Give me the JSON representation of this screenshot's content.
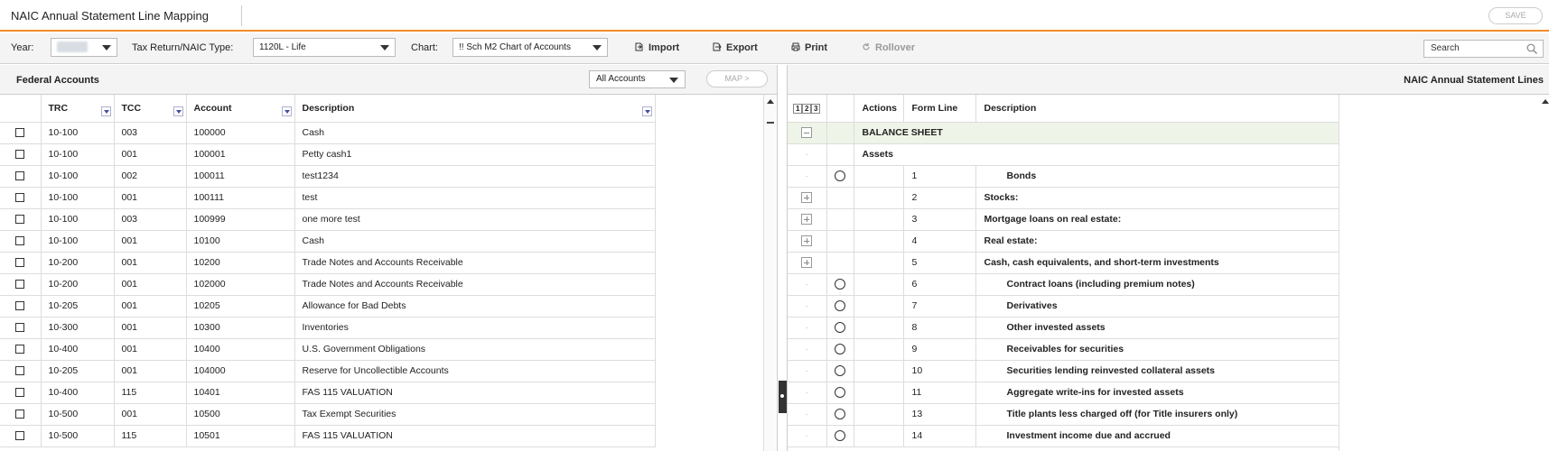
{
  "app": {
    "title": "NAIC Annual Statement Line Mapping",
    "save_label": "SAVE"
  },
  "toolbar": {
    "year_label": "Year:",
    "tax_type_label": "Tax Return/NAIC Type:",
    "tax_type_value": "1120L - Life",
    "chart_label": "Chart:",
    "chart_value": "!! Sch M2 Chart of Accounts",
    "import_label": "Import",
    "export_label": "Export",
    "print_label": "Print",
    "rollover_label": "Rollover",
    "search_placeholder": "Search"
  },
  "left_panel": {
    "title": "Federal Accounts",
    "filter_value": "All Accounts",
    "map_label": "MAP >",
    "columns": [
      "TRC",
      "TCC",
      "Account",
      "Description"
    ],
    "rows": [
      {
        "trc": "10-100",
        "tcc": "003",
        "account": "100000",
        "desc": "Cash"
      },
      {
        "trc": "10-100",
        "tcc": "001",
        "account": "100001",
        "desc": "Petty cash1"
      },
      {
        "trc": "10-100",
        "tcc": "002",
        "account": "100011",
        "desc": "test1234"
      },
      {
        "trc": "10-100",
        "tcc": "001",
        "account": "100111",
        "desc": "test"
      },
      {
        "trc": "10-100",
        "tcc": "003",
        "account": "100999",
        "desc": "one more test"
      },
      {
        "trc": "10-100",
        "tcc": "001",
        "account": "10100",
        "desc": "Cash"
      },
      {
        "trc": "10-200",
        "tcc": "001",
        "account": "10200",
        "desc": "Trade Notes and Accounts Receivable"
      },
      {
        "trc": "10-200",
        "tcc": "001",
        "account": "102000",
        "desc": "Trade Notes and Accounts Receivable"
      },
      {
        "trc": "10-205",
        "tcc": "001",
        "account": "10205",
        "desc": "Allowance for Bad Debts"
      },
      {
        "trc": "10-300",
        "tcc": "001",
        "account": "10300",
        "desc": "Inventories"
      },
      {
        "trc": "10-400",
        "tcc": "001",
        "account": "10400",
        "desc": "U.S. Government Obligations"
      },
      {
        "trc": "10-205",
        "tcc": "001",
        "account": "104000",
        "desc": "Reserve for Uncollectible Accounts"
      },
      {
        "trc": "10-400",
        "tcc": "115",
        "account": "10401",
        "desc": "FAS 115 VALUATION"
      },
      {
        "trc": "10-500",
        "tcc": "001",
        "account": "10500",
        "desc": "Tax Exempt Securities"
      },
      {
        "trc": "10-500",
        "tcc": "115",
        "account": "10501",
        "desc": "FAS 115 VALUATION"
      }
    ]
  },
  "right_panel": {
    "title": "NAIC Annual Statement Lines",
    "levels": [
      "1",
      "2",
      "3"
    ],
    "columns": [
      "Actions",
      "Form Line",
      "Description"
    ],
    "rows": [
      {
        "kind": "section",
        "line": "",
        "desc": "BALANCE SHEET"
      },
      {
        "kind": "group",
        "line": "",
        "desc": "Assets"
      },
      {
        "kind": "leaf",
        "line": "1",
        "desc": "Bonds"
      },
      {
        "kind": "expand",
        "line": "2",
        "desc": "Stocks:"
      },
      {
        "kind": "expand",
        "line": "3",
        "desc": "Mortgage loans on real estate:"
      },
      {
        "kind": "expand",
        "line": "4",
        "desc": "Real estate:"
      },
      {
        "kind": "expand",
        "line": "5",
        "desc": "Cash, cash equivalents, and short-term investments"
      },
      {
        "kind": "leaf",
        "line": "6",
        "desc": "Contract loans (including premium notes)"
      },
      {
        "kind": "leaf",
        "line": "7",
        "desc": "Derivatives"
      },
      {
        "kind": "leaf",
        "line": "8",
        "desc": "Other invested assets"
      },
      {
        "kind": "leaf",
        "line": "9",
        "desc": "Receivables for securities"
      },
      {
        "kind": "leaf",
        "line": "10",
        "desc": "Securities lending reinvested collateral assets"
      },
      {
        "kind": "leaf",
        "line": "11",
        "desc": "Aggregate write-ins for invested assets"
      },
      {
        "kind": "leaf",
        "line": "13",
        "desc": "Title plants less charged off (for Title insurers only)"
      },
      {
        "kind": "leaf",
        "line": "14",
        "desc": "Investment income due and accrued"
      }
    ]
  },
  "colors": {
    "accent": "#f28c28",
    "section_bg": "#eef4e8"
  }
}
